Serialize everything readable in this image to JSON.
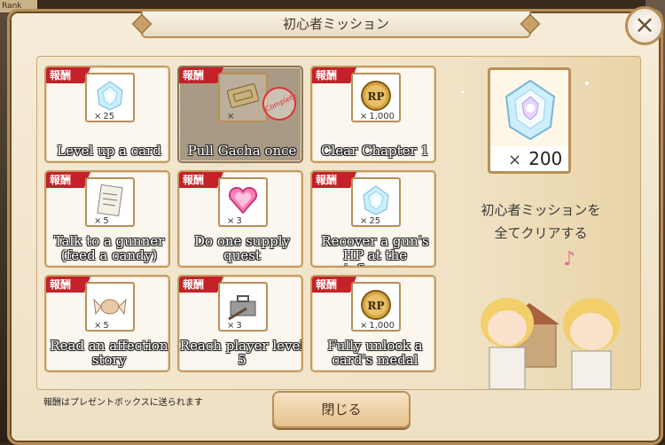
{
  "background": {
    "rank_label": "Rank"
  },
  "dialog": {
    "title": "初心者ミッション",
    "close_icon": "×"
  },
  "missions": [
    {
      "badge": "報酬",
      "label": "Level up a card",
      "reward_icon": "crystal-rose-icon",
      "quantity": "25",
      "completed": false
    },
    {
      "badge": "報酬",
      "label": "Pull Gacha once",
      "reward_icon": "ticket-icon",
      "quantity": "",
      "completed": true,
      "stamp": "Complete"
    },
    {
      "badge": "報酬",
      "label": "Clear Chapter 1",
      "reward_icon": "rp-medal-icon",
      "quantity": "1,000",
      "completed": false
    },
    {
      "badge": "報酬",
      "label": "Talk to a gunner (feed a candy)",
      "reward_icon": "letter-icon",
      "quantity": "5",
      "completed": false
    },
    {
      "badge": "報酬",
      "label": "Do one supply quest",
      "reward_icon": "heart-gem-icon",
      "quantity": "3",
      "completed": false
    },
    {
      "badge": "報酬",
      "label": "Recover a gun's HP at the infirmary",
      "reward_icon": "crystal-rose-icon",
      "quantity": "25",
      "completed": false
    },
    {
      "badge": "報酬",
      "label": "Read an affection story",
      "reward_icon": "candy-icon",
      "quantity": "5",
      "completed": false
    },
    {
      "badge": "報酬",
      "label": "Reach player level 5",
      "reward_icon": "toolbox-icon",
      "quantity": "3",
      "completed": false
    },
    {
      "badge": "報酬",
      "label": "Fully unlock a card's medal",
      "reward_icon": "rp-medal-icon",
      "quantity": "1,000",
      "completed": false
    }
  ],
  "grand_reward": {
    "icon": "crystal-rose-icon",
    "quantity": "200",
    "text_line1": "初心者ミッションを",
    "text_line2": "全てクリアする",
    "note_icon": "♪"
  },
  "footer": {
    "note": "報酬はプレゼントボックスに送られます",
    "close_label": "閉じる"
  },
  "colors": {
    "badge_red": "#c42128",
    "frame_gold": "#b98f57"
  }
}
